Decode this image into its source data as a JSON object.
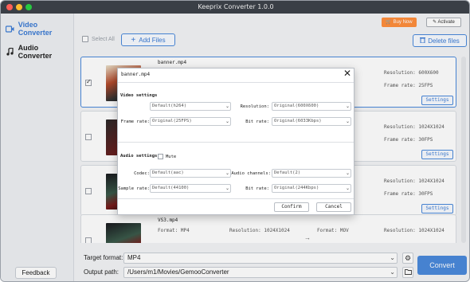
{
  "window": {
    "title": "Keeprix Converter 1.0.0"
  },
  "sidebar": {
    "items": [
      {
        "label": "Video Converter",
        "icon": "video-camera-icon",
        "active": true
      },
      {
        "label": "Audio Converter",
        "icon": "music-note-icon",
        "active": false
      }
    ],
    "feedback_label": "Feedback"
  },
  "topbar": {
    "buy_label": "Buy Now",
    "activate_label": "Activate"
  },
  "toolbar": {
    "select_all_label": "Select All",
    "add_files_label": "Add Files",
    "delete_files_label": "Delete files"
  },
  "files": [
    {
      "name": "banner.mp4",
      "checked": true,
      "resolution": "Resolution: 600X600",
      "frame_rate": "Frame rate: 25FPS",
      "settings_label": "Settings"
    },
    {
      "name": "",
      "checked": false,
      "resolution": "Resolution: 1024X1024",
      "frame_rate": "Frame rate: 30FPS",
      "settings_label": "Settings"
    },
    {
      "name": "",
      "checked": false,
      "resolution": "Resolution: 1024X1024",
      "frame_rate": "Frame rate: 30FPS",
      "settings_label": "Settings"
    },
    {
      "name": "VS3.mp4",
      "checked": false,
      "format_left": "Format:   MP4",
      "resolution_left": "Resolution: 1024X1024",
      "format_right": "Format:   MOV",
      "resolution_right": "Resolution: 1024X1024"
    }
  ],
  "bottom": {
    "target_format_label": "Target format:",
    "target_format_value": "MP4",
    "output_path_label": "Output path:",
    "output_path_value": "/Users/m1/Movies/GemooConverter",
    "convert_label": "Convert"
  },
  "dialog": {
    "title": "banner.mp4",
    "video_section": "Video settings",
    "codec_label": "Codec:",
    "codec_value": "Default(h264)",
    "resolution_label": "Resolution:",
    "resolution_value": "Original(600X600)",
    "frame_rate_label": "Frame rate:",
    "frame_rate_value": "Original(25FPS)",
    "bit_rate_label": "Bit rate:",
    "bit_rate_value": "Original(6033Kbps)",
    "audio_section": "Audio settings",
    "mute_label": "Mute",
    "acodec_label": "Codec:",
    "acodec_value": "Default(aac)",
    "channels_label": "Audio channels:",
    "channels_value": "Default(2)",
    "sample_rate_label": "Sample rate:",
    "sample_rate_value": "Default(44100)",
    "abit_rate_label": "Bit rate:",
    "abit_rate_value": "Original(244Kbps)",
    "confirm_label": "Confirm",
    "cancel_label": "Cancel"
  }
}
